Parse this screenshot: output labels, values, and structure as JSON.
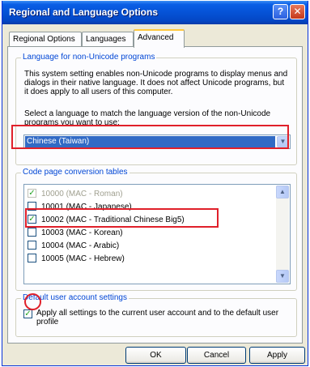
{
  "window": {
    "title": "Regional and Language Options",
    "help_glyph": "?",
    "close_glyph": "✕"
  },
  "tabs": [
    {
      "label": "Regional Options"
    },
    {
      "label": "Languages"
    },
    {
      "label": "Advanced",
      "active": true
    }
  ],
  "non_unicode": {
    "legend": "Language for non-Unicode programs",
    "description": "This system setting enables non-Unicode programs to display menus and dialogs in their native language. It does not affect Unicode programs, but it does apply to all users of this computer.",
    "select_prompt": "Select a language to match the language version of the non-Unicode programs you want to use:",
    "selected_language": "Chinese (Taiwan)"
  },
  "code_pages": {
    "legend": "Code page conversion tables",
    "items": [
      {
        "label": "10000 (MAC - Roman)",
        "checked": true,
        "disabled": true
      },
      {
        "label": "10001 (MAC - Japanese)",
        "checked": false,
        "disabled": false
      },
      {
        "label": "10002 (MAC - Traditional Chinese Big5)",
        "checked": true,
        "disabled": false
      },
      {
        "label": "10003 (MAC - Korean)",
        "checked": false,
        "disabled": false
      },
      {
        "label": "10004 (MAC - Arabic)",
        "checked": false,
        "disabled": false
      },
      {
        "label": "10005 (MAC - Hebrew)",
        "checked": false,
        "disabled": false
      }
    ]
  },
  "default_user": {
    "legend": "Default user account settings",
    "checkbox_label": "Apply all settings to the current user account and to the default user profile",
    "checked": true
  },
  "buttons": {
    "ok": "OK",
    "cancel": "Cancel",
    "apply": "Apply"
  },
  "colors": {
    "highlight_red": "#e0202a",
    "selection_blue": "#316ac5",
    "legend_blue": "#0046d5"
  }
}
